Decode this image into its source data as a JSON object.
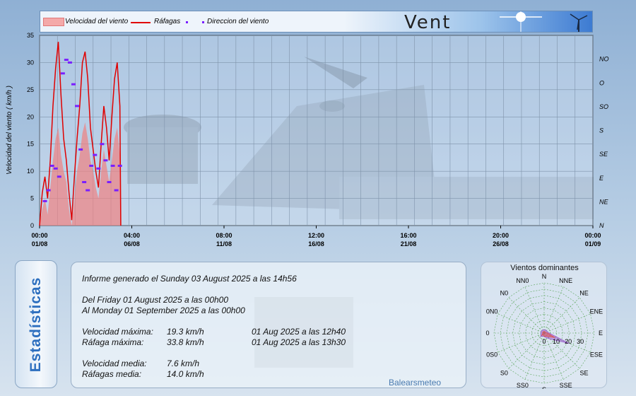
{
  "banner": {
    "title": "Vent"
  },
  "legend": [
    {
      "label": "Velocidad del viento",
      "color": "#f08080"
    },
    {
      "label": "Ráfagas",
      "color": "#e00000"
    },
    {
      "label": "Direccion del viento",
      "color": "#7a1fff"
    }
  ],
  "chart_data": [
    {
      "type": "line",
      "ylabel": "Velocidad del viento ( km/h )",
      "ylim": [
        0,
        35
      ],
      "y_ticks": [
        "0",
        "5",
        "10",
        "15",
        "20",
        "25",
        "30",
        "35"
      ],
      "y2_ticks": [
        "N",
        "NE",
        "E",
        "SE",
        "S",
        "SO",
        "O",
        "NO"
      ],
      "x_ticks": [
        {
          "time": "00:00",
          "date": "01/08"
        },
        {
          "time": "04:00",
          "date": "06/08"
        },
        {
          "time": "08:00",
          "date": "11/08"
        },
        {
          "time": "12:00",
          "date": "16/08"
        },
        {
          "time": "16:00",
          "date": "21/08"
        },
        {
          "time": "20:00",
          "date": "26/08"
        },
        {
          "time": "00:00",
          "date": "01/09"
        }
      ],
      "x_day_range": [
        0,
        31
      ],
      "grid": true,
      "series": [
        {
          "name": "Velocidad del viento",
          "style": "area",
          "color": "#f08080",
          "x": [
            0.0,
            0.15,
            0.3,
            0.45,
            0.6,
            0.75,
            0.9,
            1.05,
            1.2,
            1.35,
            1.5,
            1.65,
            1.8,
            1.95,
            2.1,
            2.25,
            2.4,
            2.55,
            2.7,
            2.85,
            3.0,
            3.15,
            3.3,
            3.45,
            3.6,
            3.75,
            3.9,
            4.05,
            4.2,
            4.35,
            4.5,
            4.55
          ],
          "values": [
            0,
            3,
            5,
            2,
            7,
            12,
            16,
            18,
            13,
            10,
            8,
            3,
            0,
            5,
            10,
            13,
            17,
            19,
            16,
            12,
            10,
            7,
            5,
            10,
            14,
            11,
            8,
            12,
            16,
            18,
            13,
            0
          ]
        },
        {
          "name": "Ráfagas",
          "style": "line",
          "color": "#e00000",
          "x": [
            0.0,
            0.15,
            0.3,
            0.45,
            0.6,
            0.75,
            0.9,
            1.05,
            1.2,
            1.35,
            1.5,
            1.65,
            1.8,
            1.95,
            2.1,
            2.25,
            2.4,
            2.55,
            2.7,
            2.85,
            3.0,
            3.15,
            3.3,
            3.45,
            3.6,
            3.75,
            3.9,
            4.05,
            4.2,
            4.35,
            4.5,
            4.55
          ],
          "values": [
            0,
            6,
            9,
            5,
            12,
            22,
            29,
            33.8,
            24,
            16,
            12,
            6,
            1,
            9,
            16,
            22,
            30,
            32,
            27,
            18,
            14,
            10,
            7,
            15,
            22,
            18,
            12,
            20,
            27,
            30,
            22,
            0
          ]
        },
        {
          "name": "Direccion del viento",
          "style": "points",
          "color": "#7a1fff",
          "x": [
            0.3,
            0.5,
            0.7,
            0.9,
            1.1,
            1.3,
            1.5,
            1.7,
            1.9,
            2.1,
            2.3,
            2.5,
            2.7,
            2.9,
            3.1,
            3.3,
            3.5,
            3.7,
            3.9,
            4.1,
            4.3,
            4.5
          ],
          "values": [
            4.5,
            6.5,
            11,
            10.5,
            9,
            28,
            30.5,
            30,
            26,
            22,
            14,
            8,
            6.5,
            11,
            13,
            10.5,
            15,
            12,
            8,
            11,
            6.5,
            11
          ]
        }
      ]
    },
    {
      "type": "radar",
      "title": "Vientos dominantes",
      "directions": [
        "N",
        "NNE",
        "NE",
        "ENE",
        "E",
        "ESE",
        "SE",
        "SSE",
        "S",
        "SS0",
        "S0",
        "0S0",
        "0",
        "0N0",
        "N0",
        "NN0"
      ],
      "r_ticks": [
        "0",
        "10",
        "20",
        "30"
      ],
      "rlim": [
        0,
        30
      ],
      "series": [
        {
          "name": "frequency",
          "color": "#9b59d0",
          "values": [
            2,
            2,
            2,
            2,
            3,
            16,
            5,
            3,
            2,
            2,
            3,
            2,
            2,
            2,
            2,
            2
          ]
        },
        {
          "name": "speed",
          "color": "#e05050",
          "values": [
            1,
            1,
            1,
            1,
            2,
            7,
            3,
            2,
            2,
            1,
            2,
            1,
            1,
            1,
            1,
            1
          ]
        }
      ]
    }
  ],
  "stats": {
    "report": "Informe generado el Sunday 03 August 2025 a las 14h56",
    "from": "Del Friday 01 August 2025 a las 00h00",
    "to": "Al Monday 01 September 2025 a las 00h00",
    "max_speed_label": "Velocidad máxima:",
    "max_speed_value": "19.3 km/h",
    "max_speed_date": "01 Aug 2025 a las 12h40",
    "max_gust_label": "Ráfaga máxima:",
    "max_gust_value": "33.8 km/h",
    "max_gust_date": "01 Aug 2025 a las 13h30",
    "avg_speed_label": "Velocidad media:",
    "avg_speed_value": "7.6 km/h",
    "avg_gust_label": "Ráfagas media:",
    "avg_gust_value": "14.0 km/h",
    "brand": "Balearsmeteo"
  },
  "tab": {
    "label": "Estadísticas"
  },
  "rose": {
    "title": "Vientos dominantes"
  }
}
